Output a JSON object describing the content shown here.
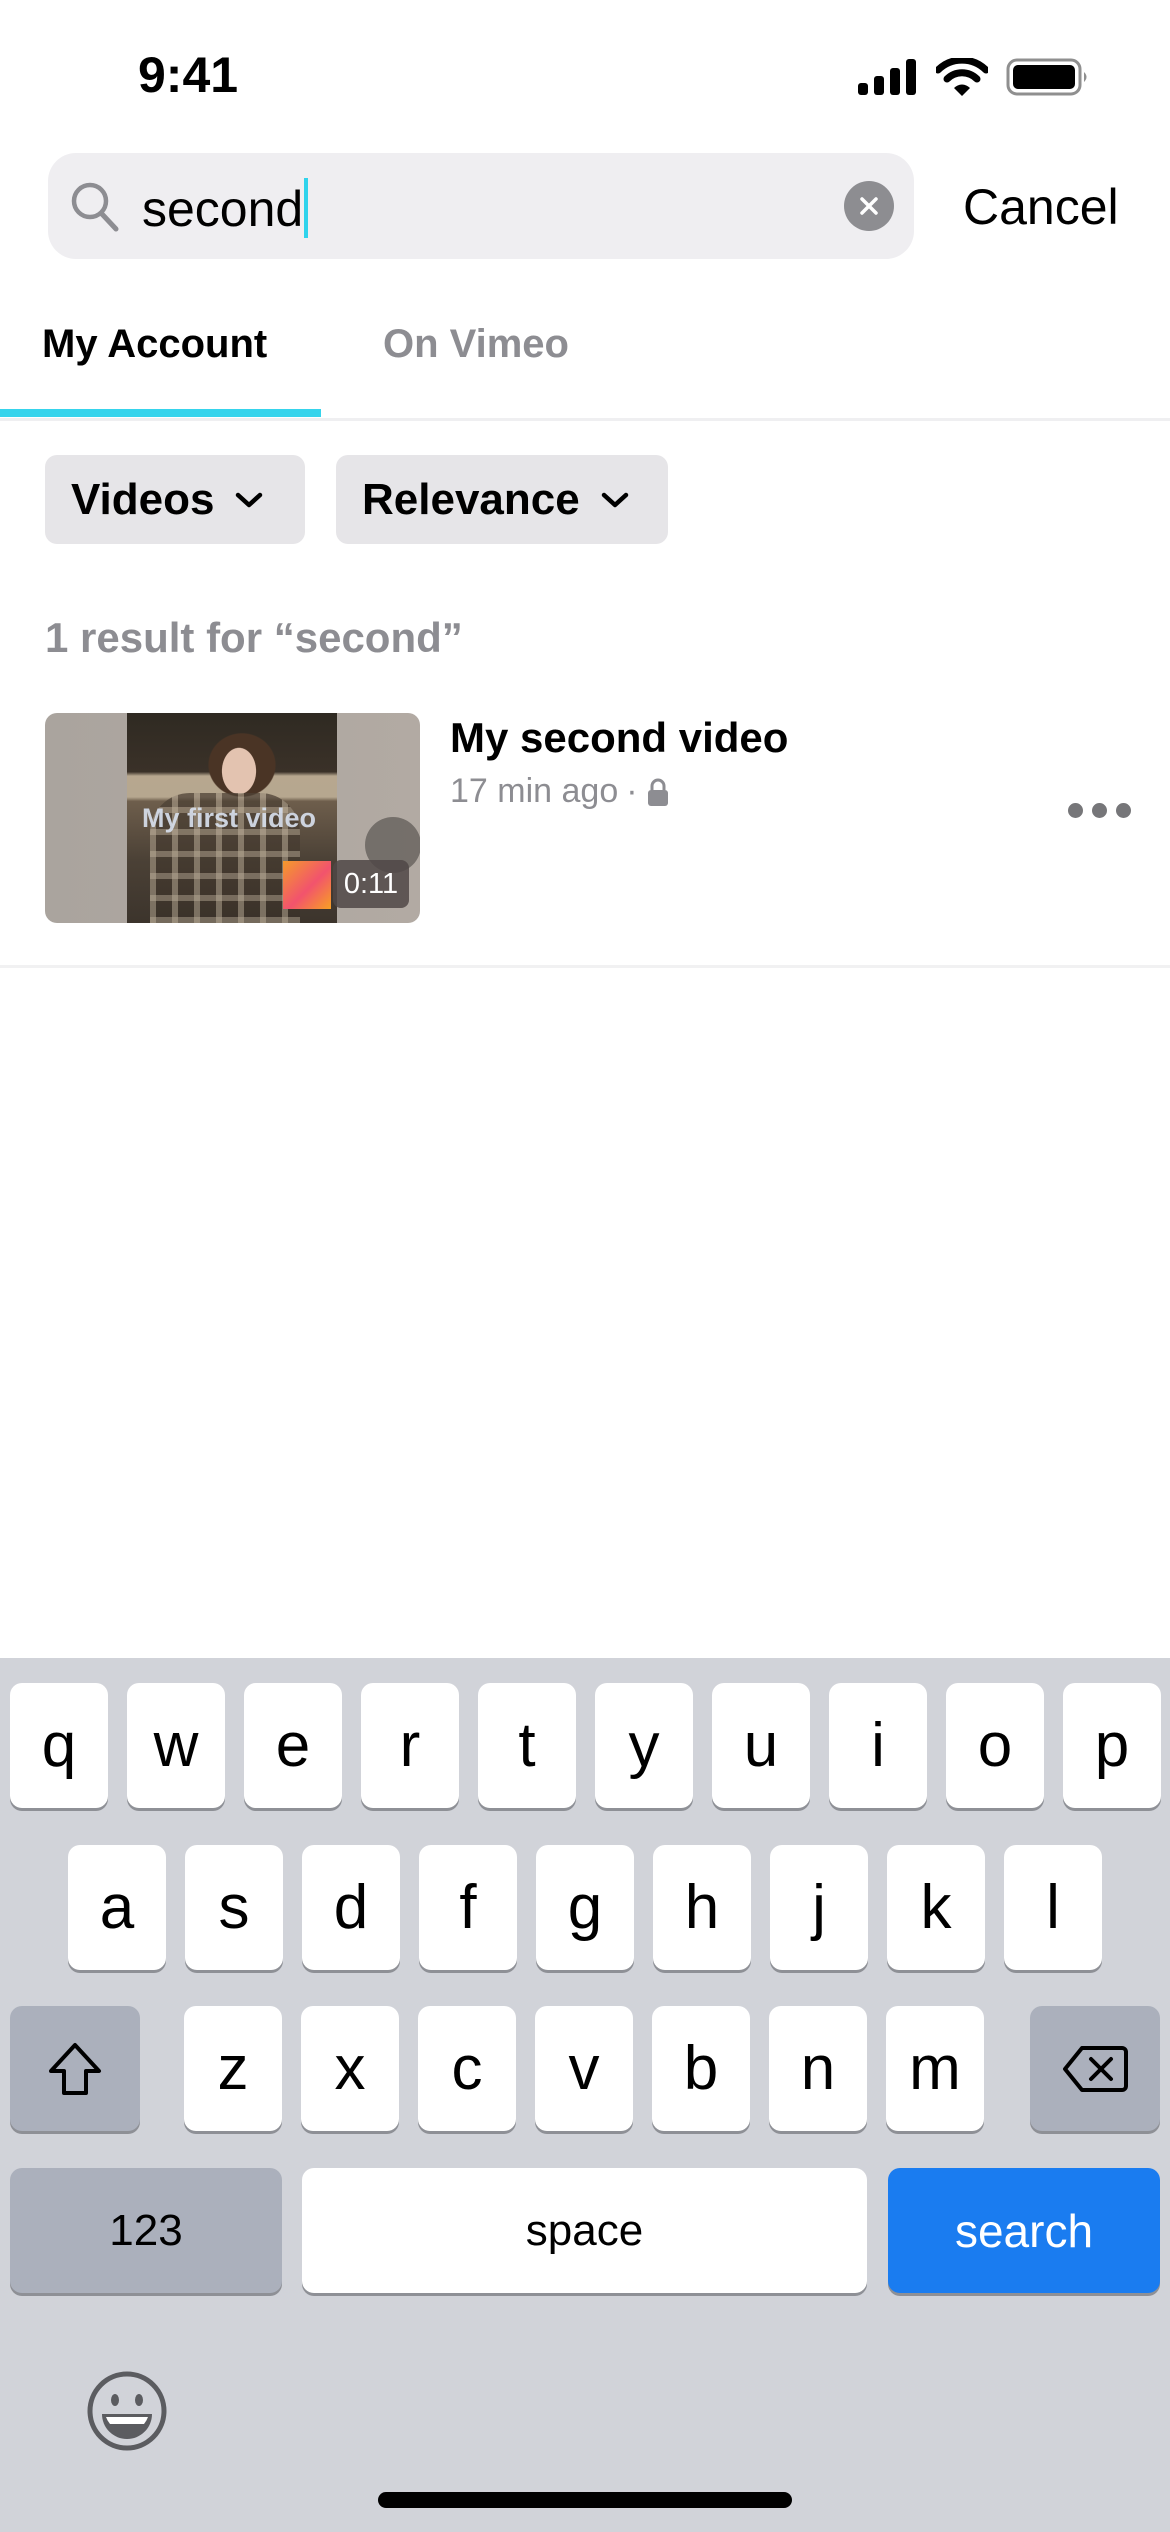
{
  "status_bar": {
    "time": "9:41",
    "icons": [
      "cellular-signal-icon",
      "wifi-icon",
      "battery-icon"
    ]
  },
  "search": {
    "value": "second",
    "placeholder": "",
    "clear_icon": "clear-icon",
    "search_icon": "search-icon",
    "cancel_label": "Cancel"
  },
  "tabs": [
    {
      "label": "My Account",
      "active": true
    },
    {
      "label": "On Vimeo",
      "active": false
    }
  ],
  "filters": {
    "type": {
      "label": "Videos",
      "icon": "chevron-down-icon"
    },
    "sort": {
      "label": "Relevance",
      "icon": "chevron-down-icon"
    }
  },
  "results": {
    "summary": "1 result for “second”",
    "items": [
      {
        "title": "My second video",
        "age": "17 min ago",
        "separator": "·",
        "privacy_icon": "lock-icon",
        "duration": "0:11",
        "thumbnail_overlay_text": "My first video"
      }
    ]
  },
  "keyboard": {
    "row1": [
      "q",
      "w",
      "e",
      "r",
      "t",
      "y",
      "u",
      "i",
      "o",
      "p"
    ],
    "row2": [
      "a",
      "s",
      "d",
      "f",
      "g",
      "h",
      "j",
      "k",
      "l"
    ],
    "row3": [
      "z",
      "x",
      "c",
      "v",
      "b",
      "n",
      "m"
    ],
    "num_label": "123",
    "space_label": "space",
    "action_label": "search",
    "colors": {
      "action": "#1a7cf0",
      "background": "#d1d3d9"
    }
  },
  "colors": {
    "accent": "#36d4ec",
    "caret": "#2fd3ec",
    "muted_text": "#8d8d92"
  }
}
